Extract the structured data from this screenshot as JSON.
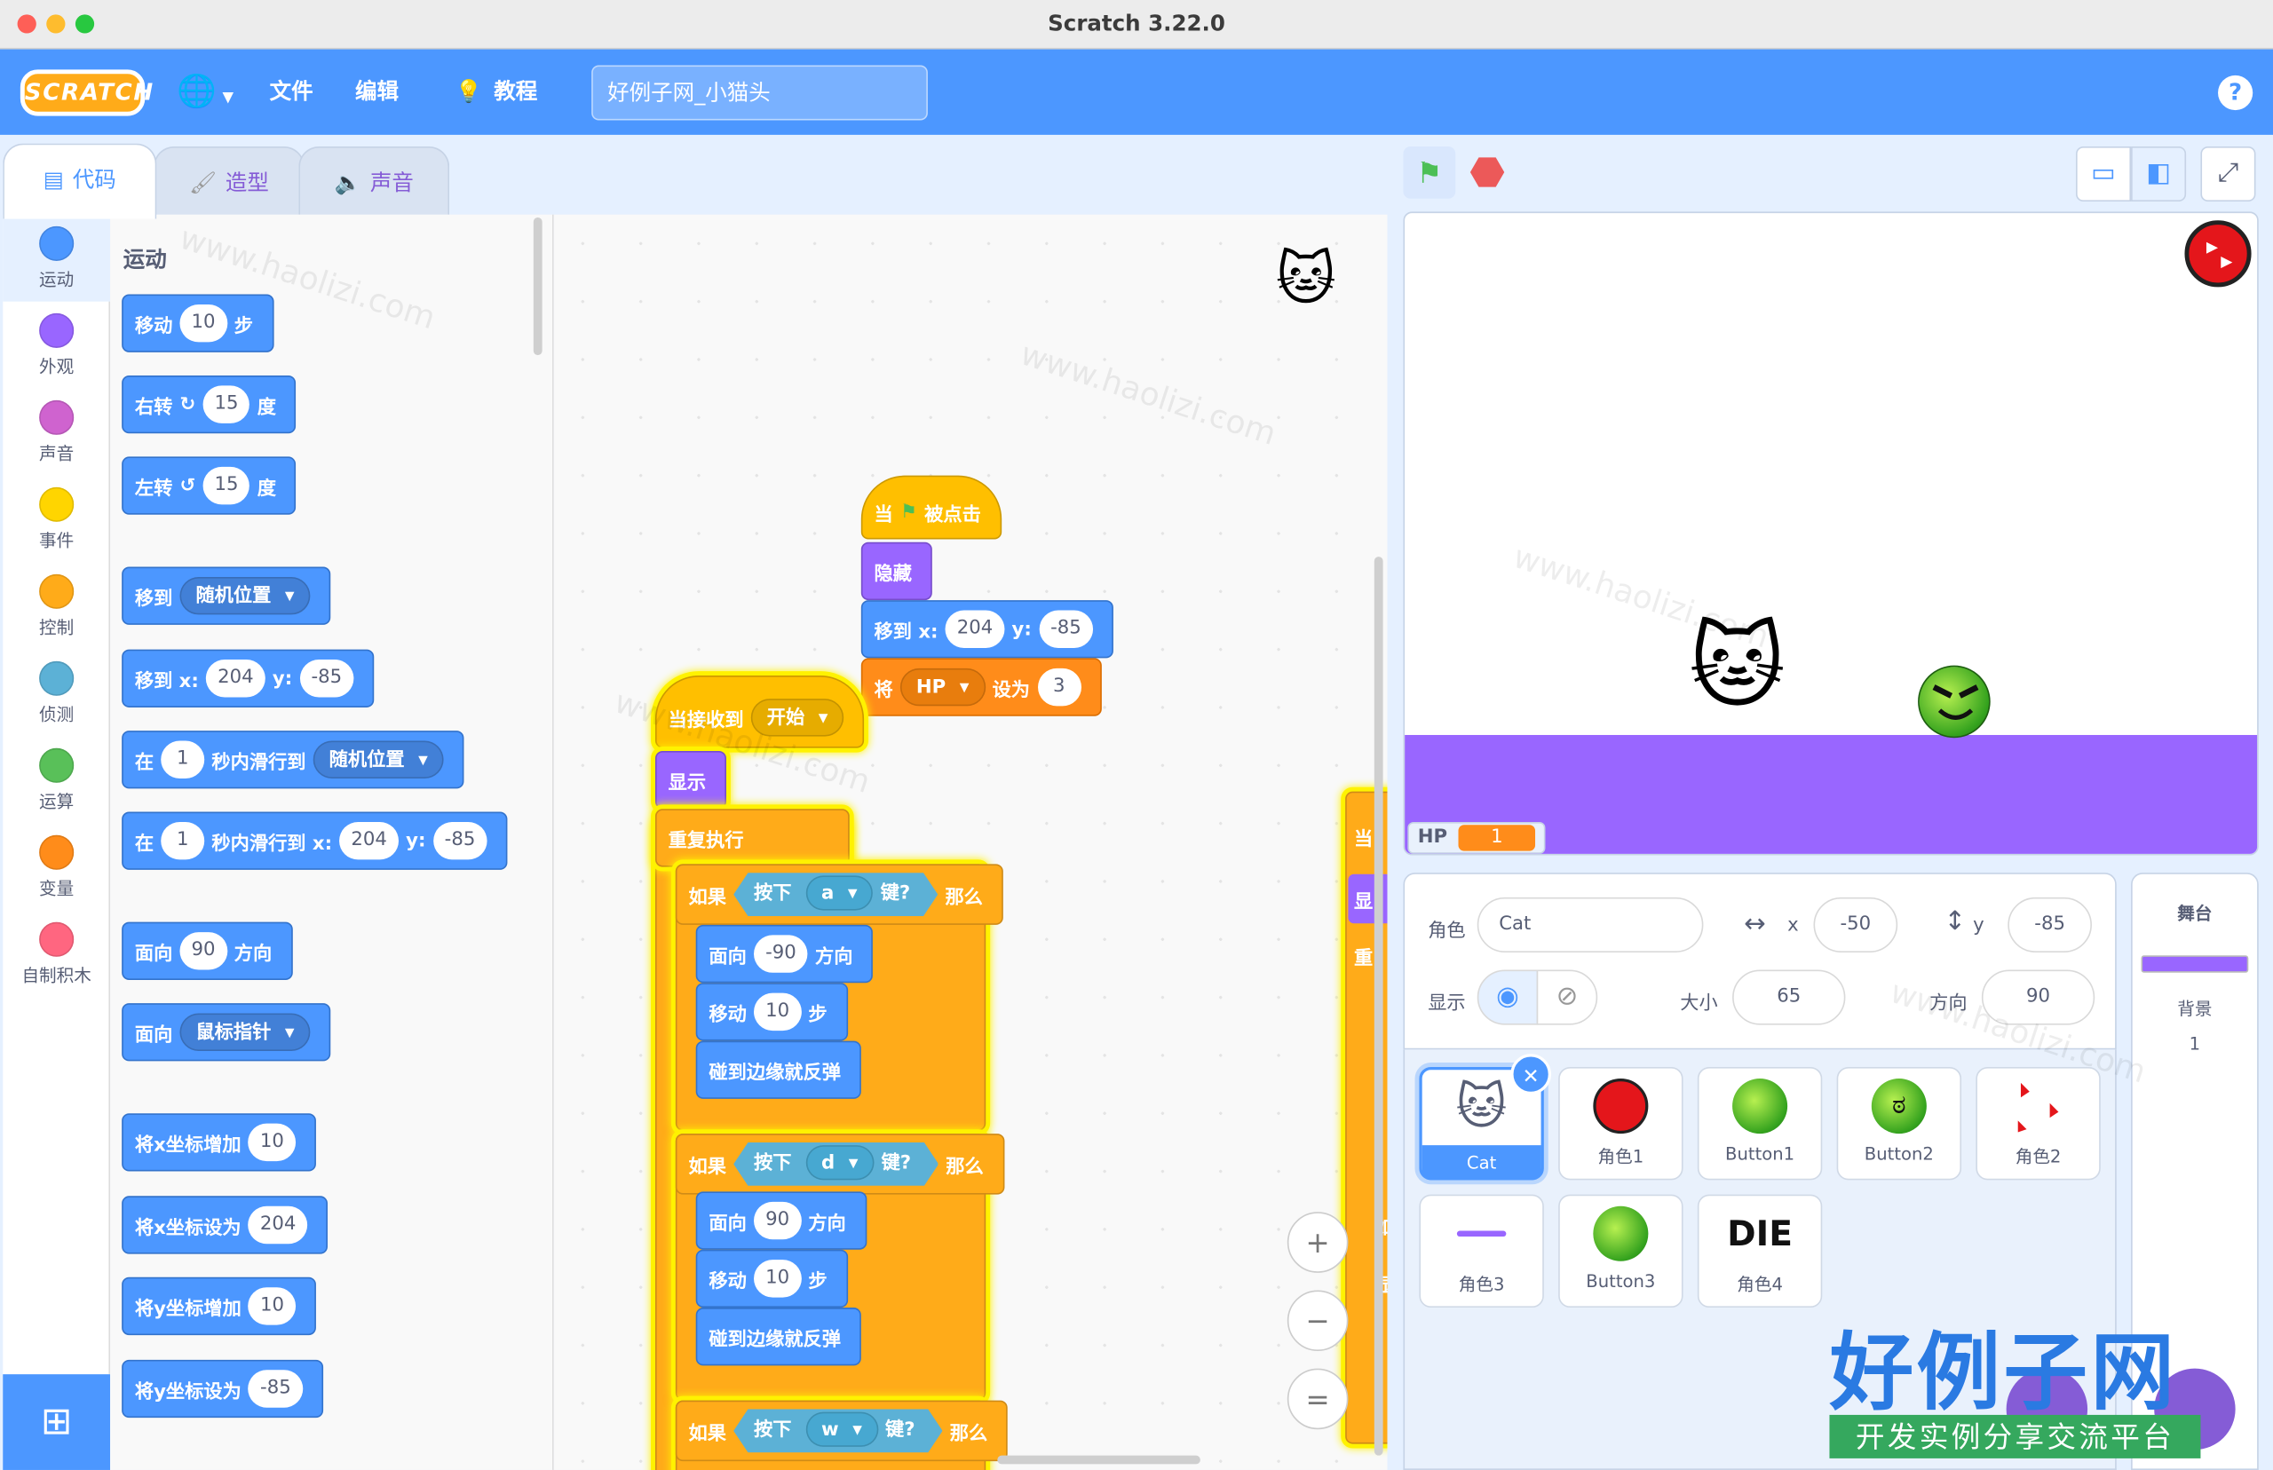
{
  "window": {
    "title": "Scratch 3.22.0"
  },
  "menu": {
    "logo": "SCRATCH",
    "file": "文件",
    "edit": "编辑",
    "tutorials": "教程",
    "project_title": "好例子网_小猫头",
    "help": "?"
  },
  "tabs": {
    "code": "代码",
    "costumes": "造型",
    "sounds": "声音"
  },
  "categories": [
    {
      "label": "运动",
      "color": "#4c97ff"
    },
    {
      "label": "外观",
      "color": "#9966ff"
    },
    {
      "label": "声音",
      "color": "#cf63cf"
    },
    {
      "label": "事件",
      "color": "#ffd500"
    },
    {
      "label": "控制",
      "color": "#ffab19"
    },
    {
      "label": "侦测",
      "color": "#5cb1d6"
    },
    {
      "label": "运算",
      "color": "#59c059"
    },
    {
      "label": "变量",
      "color": "#ff8c1a"
    },
    {
      "label": "自制积木",
      "color": "#ff6680"
    }
  ],
  "palette": {
    "heading": "运动",
    "move": {
      "a": "移动",
      "v": "10",
      "b": "步"
    },
    "turn_right": {
      "a": "右转",
      "v": "15",
      "b": "度"
    },
    "turn_left": {
      "a": "左转",
      "v": "15",
      "b": "度"
    },
    "goto": {
      "a": "移到",
      "drop": "随机位置"
    },
    "goto_xy": {
      "a": "移到 x:",
      "x": "204",
      "ylab": "y:",
      "y": "-85"
    },
    "glide": {
      "a": "在",
      "v": "1",
      "b": "秒内滑行到",
      "drop": "随机位置"
    },
    "glide_xy": {
      "a": "在",
      "v": "1",
      "b": "秒内滑行到 x:",
      "x": "204",
      "ylab": "y:",
      "y": "-85"
    },
    "point_dir": {
      "a": "面向",
      "v": "90",
      "b": "方向"
    },
    "point_to": {
      "a": "面向",
      "drop": "鼠标指针"
    },
    "change_x": {
      "a": "将x坐标增加",
      "v": "10"
    },
    "set_x": {
      "a": "将x坐标设为",
      "v": "204"
    },
    "change_y": {
      "a": "将y坐标增加",
      "v": "10"
    },
    "set_y": {
      "a": "将y坐标设为",
      "v": "-85"
    }
  },
  "scripts": {
    "s1": {
      "hat": {
        "a": "当",
        "b": "被点击"
      },
      "hide": "隐藏",
      "goto": {
        "a": "移到 x:",
        "x": "204",
        "ylab": "y:",
        "y": "-85"
      },
      "setvar": {
        "a": "将",
        "drop": "HP",
        "b": "设为",
        "v": "3"
      }
    },
    "s2": {
      "hat": {
        "a": "当接收到",
        "drop": "开始"
      },
      "show": "显示",
      "forever": "重复执行",
      "if1": {
        "a": "如果",
        "key_a": "按下",
        "key": "a",
        "key_b": "键?",
        "then": "那么"
      },
      "if1_body": [
        {
          "a": "面向",
          "v": "-90",
          "b": "方向"
        },
        {
          "a": "移动",
          "v": "10",
          "b": "步"
        },
        {
          "a": "碰到边缘就反弹"
        }
      ],
      "if2": {
        "a": "如果",
        "key_a": "按下",
        "key": "d",
        "key_b": "键?",
        "then": "那么"
      },
      "if2_body": [
        {
          "a": "面向",
          "v": "90",
          "b": "方向"
        },
        {
          "a": "移动",
          "v": "10",
          "b": "步"
        },
        {
          "a": "碰到边缘就反弹"
        }
      ],
      "if3": {
        "a": "如果",
        "key_a": "按下",
        "key": "w",
        "key_b": "键?",
        "then": "那么"
      }
    },
    "s3_partial": {
      "hat": "当",
      "show": "显",
      "rep": "重",
      "if": "如",
      "body": "显"
    }
  },
  "zoom": {
    "in": "+",
    "out": "−",
    "reset": "="
  },
  "stage": {
    "monitor_label": "HP",
    "monitor_value": "1"
  },
  "sprite_info": {
    "sprite_label": "角色",
    "sprite_name": "Cat",
    "x_label": "x",
    "x": "-50",
    "y_label": "y",
    "y": "-85",
    "show_label": "显示",
    "size_label": "大小",
    "size": "65",
    "dir_label": "方向",
    "direction": "90"
  },
  "sprites": [
    {
      "name": "Cat",
      "icon": "cat-icon"
    },
    {
      "name": "角色1",
      "icon": "red-ball-icon"
    },
    {
      "name": "Button1",
      "icon": "green-ball-icon"
    },
    {
      "name": "Button2",
      "icon": "angry-face-icon"
    },
    {
      "name": "角色2",
      "icon": "red-arrows-icon"
    },
    {
      "name": "角色3",
      "icon": "purple-line-icon"
    },
    {
      "name": "Button3",
      "icon": "green-ball-icon"
    },
    {
      "name": "角色4",
      "icon": "die-text-icon",
      "thumb_text": "DIE"
    }
  ],
  "stage_pane": {
    "title": "舞台",
    "backdrops_label": "背景",
    "backdrops_count": "1"
  },
  "watermark": {
    "main": "好例子网",
    "sub": "开发实例分享交流平台",
    "tile": "www.haolizi.com"
  }
}
